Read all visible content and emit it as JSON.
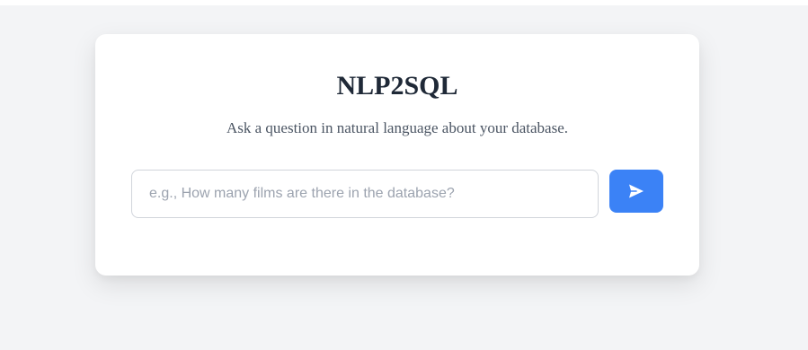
{
  "app": {
    "title": "NLP2SQL",
    "subtitle": "Ask a question in natural language about your database."
  },
  "query": {
    "value": "",
    "placeholder": "e.g., How many films are there in the database?"
  },
  "send_button": {
    "icon": "send-icon"
  },
  "colors": {
    "page_background": "#f3f4f6",
    "card_background": "#ffffff",
    "accent": "#3b82f6",
    "title_text": "#1f2937",
    "subtitle_text": "#4b5563",
    "placeholder_text": "#9ca3af"
  }
}
